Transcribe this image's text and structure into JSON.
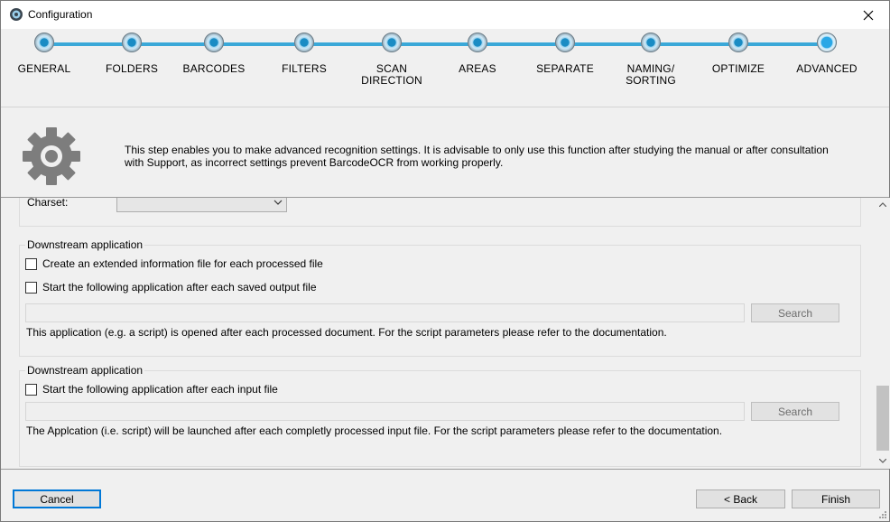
{
  "window": {
    "title": "Configuration"
  },
  "steps": [
    {
      "label": "GENERAL"
    },
    {
      "label": "FOLDERS"
    },
    {
      "label": "BARCODES"
    },
    {
      "label": "FILTERS"
    },
    {
      "label": "SCAN\nDIRECTION"
    },
    {
      "label": "AREAS"
    },
    {
      "label": "SEPARATE"
    },
    {
      "label": "NAMING/\nSORTING"
    },
    {
      "label": "OPTIMIZE"
    },
    {
      "label": "ADVANCED"
    }
  ],
  "active_step": "ADVANCED",
  "banner": {
    "text": "This step enables you to make advanced recognition settings. It is advisable to only use this function after studying the manual or after consultation with Support, as incorrect settings prevent BarcodeOCR from working properly."
  },
  "charset": {
    "label": "Charset:",
    "value": ""
  },
  "group1": {
    "legend": "Downstream application",
    "check1": "Create an extended information file for each processed file",
    "check2": "Start the following application after each saved output file",
    "path_value": "",
    "search_label": "Search",
    "hint": "This application (e.g. a script) is opened after each processed document. For the script parameters please refer to the documentation."
  },
  "group2": {
    "legend": "Downstream application",
    "check1": "Start the following application after each input file",
    "path_value": "",
    "search_label": "Search",
    "hint": "The Applcation (i.e. script) will be launched after each completly processed input file. For the script parameters please refer to the documentation."
  },
  "footer": {
    "cancel_label": "Cancel",
    "back_label": "< Back",
    "finish_label": "Finish"
  },
  "colors": {
    "accent": "#3aa8d8",
    "focus": "#0078d7"
  }
}
